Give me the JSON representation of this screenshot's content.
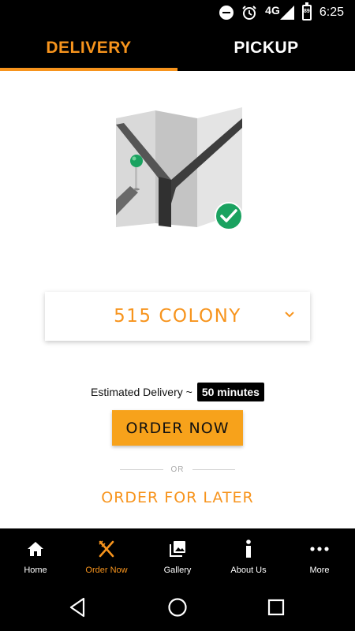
{
  "status_bar": {
    "network": "4G",
    "battery": "89",
    "time": "6:25"
  },
  "tabs": [
    {
      "label": "DELIVERY",
      "active": true
    },
    {
      "label": "PICKUP",
      "active": false
    }
  ],
  "illustration": {
    "icon": "map-with-pin-and-check"
  },
  "location": {
    "selected": "515 COLONY"
  },
  "delivery": {
    "estimate_label": "Estimated Delivery ~",
    "estimate_value": "50 minutes"
  },
  "actions": {
    "order_now": "ORDER NOW",
    "or": "OR",
    "order_later": "ORDER FOR LATER"
  },
  "bottom_nav": [
    {
      "label": "Home",
      "icon": "home-icon",
      "active": false
    },
    {
      "label": "Order Now",
      "icon": "utensils-icon",
      "active": true
    },
    {
      "label": "Gallery",
      "icon": "gallery-icon",
      "active": false
    },
    {
      "label": "About Us",
      "icon": "info-icon",
      "active": false
    },
    {
      "label": "More",
      "icon": "more-icon",
      "active": false
    }
  ],
  "colors": {
    "accent": "#f7941d",
    "button": "#f7a21b",
    "bar": "#000000",
    "check_green": "#1aa260"
  }
}
